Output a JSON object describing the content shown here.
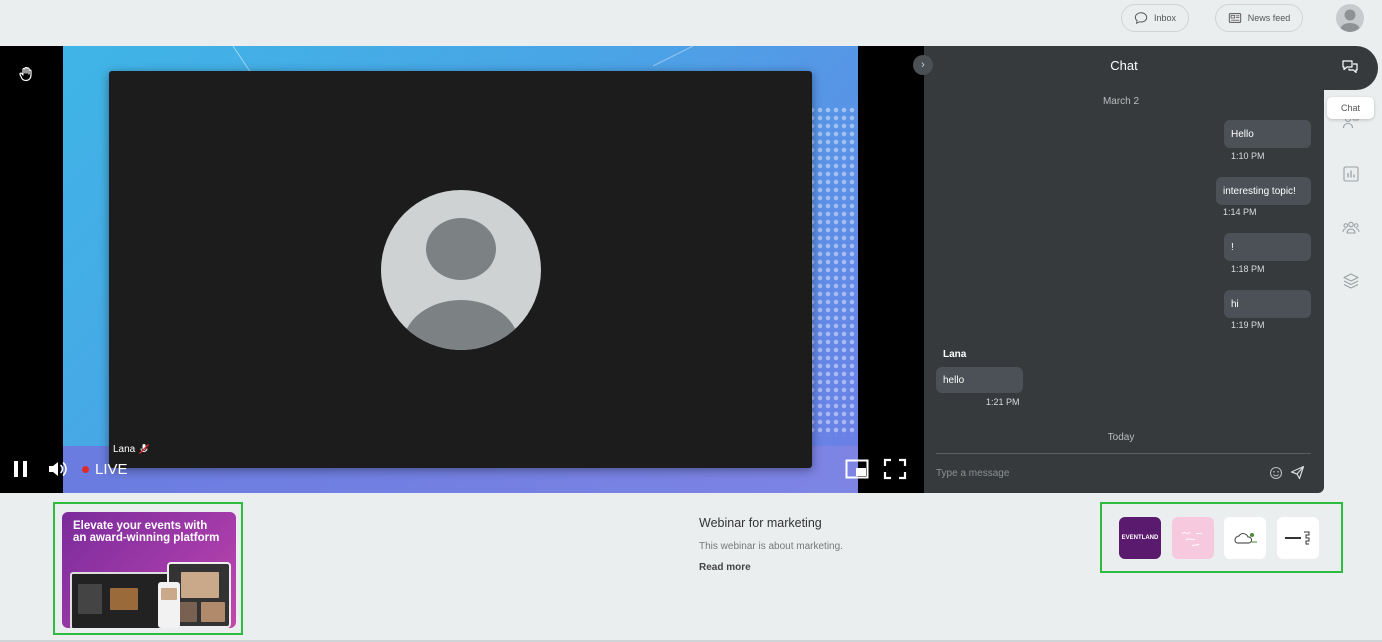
{
  "topbar": {
    "inbox_label": "Inbox",
    "newsfeed_label": "News feed"
  },
  "stage": {
    "speaker_name": "Lana",
    "live_label": "LIVE"
  },
  "chat": {
    "title": "Chat",
    "date_separator_1": "March 2",
    "date_separator_2": "Today",
    "messages": [
      {
        "text": "Hello",
        "time": "1:10 PM",
        "own": true
      },
      {
        "text": "interesting topic!",
        "time": "1:14 PM",
        "own": true
      },
      {
        "text": "!",
        "time": "1:18 PM",
        "own": true
      },
      {
        "text": "hi",
        "time": "1:19 PM",
        "own": true
      },
      {
        "sender": "Lana",
        "text": "hello",
        "time": "1:21 PM",
        "own": false
      }
    ],
    "input_placeholder": "Type a message"
  },
  "rail": {
    "tooltip": "Chat",
    "icons": [
      "chat-icon",
      "people-speaking-icon",
      "poll-chart-icon",
      "attendees-icon",
      "layers-icon"
    ]
  },
  "banner": {
    "text": "Elevate your events with an award-winning platform"
  },
  "event": {
    "title": "Webinar for marketing",
    "description": "This webinar is about marketing.",
    "read_more": "Read more"
  },
  "sponsors": {
    "items": [
      {
        "name": "EVENTLAND",
        "bg": "#5a1a6e",
        "fg": "#ffffff"
      },
      {
        "name": "",
        "bg": "#f7c9de",
        "fg": "#ffffff"
      },
      {
        "name": "",
        "bg": "#ffffff",
        "fg": "#4a8a3a"
      },
      {
        "name": "",
        "bg": "#ffffff",
        "fg": "#333333"
      }
    ]
  },
  "colors": {
    "accent_green": "#2dbd3e",
    "chat_bg": "#363a3d",
    "live_red": "#e12a2a"
  }
}
